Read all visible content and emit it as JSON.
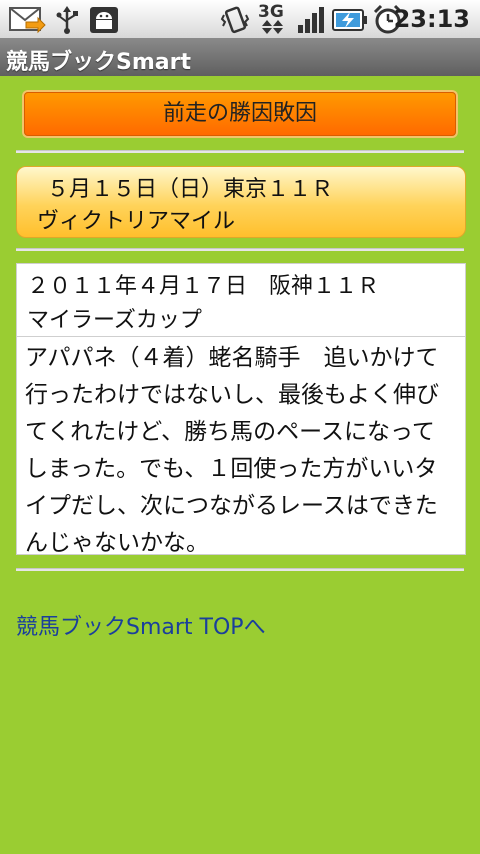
{
  "status_bar": {
    "time": "23:13",
    "network": "3G",
    "icons": [
      "mail-icon",
      "usb-icon",
      "android-icon",
      "vibrate-icon",
      "signal-icon",
      "battery-icon",
      "alarm-icon"
    ]
  },
  "app": {
    "title": "競馬ブックSmart"
  },
  "page": {
    "header_button": "前走の勝因敗因",
    "race": {
      "date_venue": "５月１５日（日）東京１１Ｒ",
      "name": "ヴィクトリアマイル"
    },
    "previous_race": {
      "date_venue": "２０１１年４月１７日　阪神１１Ｒ",
      "name": "マイラーズカップ",
      "comment": "アパパネ（４着）蛯名騎手　追いかけて行ったわけではないし、最後もよく伸びてくれたけど、勝ち馬のペースになってしまった。でも、１回使った方がいいタイプだし、次につながるレースはできたんじゃないかな。"
    },
    "top_link": "競馬ブックSmart TOPへ"
  },
  "colors": {
    "background": "#9acd32",
    "header_button": "#ff7a00",
    "link": "#1a3f9c"
  }
}
